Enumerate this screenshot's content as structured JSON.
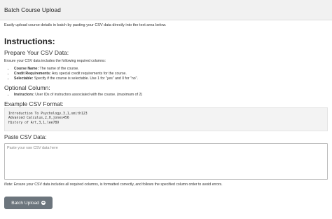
{
  "header": {
    "title": "Batch Course Upload"
  },
  "intro": "Easily upload course details in batch by pasting your CSV data directly into the text area below.",
  "instructions": {
    "heading": "Instructions:",
    "prepare_heading": "Prepare Your CSV Data:",
    "ensure_text": "Ensure your CSV data includes the following required columns:",
    "required": [
      {
        "term": "Course Name:",
        "desc": " The name of the course."
      },
      {
        "term": "Credit Requirements:",
        "desc": " Any special credit requirements for the course."
      },
      {
        "term": "Selectable:",
        "desc": " Specify if the course is selectable. Use 1 for \"yes\" and 0 for \"no\"."
      }
    ],
    "optional_heading": "Optional Column:",
    "optional": [
      {
        "term": "Instructors:",
        "desc": " User IDs of instructors associated with the course. (maximum of 2)"
      }
    ],
    "example_heading": "Example CSV Format:",
    "example_lines": [
      "Introduction To Psychology,3,1,smith123",
      "Advanced Calculus,2,0,jones456",
      "History of Art,3,1,lee789"
    ]
  },
  "paste": {
    "heading": "Paste CSV Data:",
    "placeholder": "Paste your raw CSV data here"
  },
  "note": {
    "label": "Note:",
    "text": " Ensure your CSV data includes all required columns, is formatted correctly, and follows the specified column order to avoid errors."
  },
  "button": {
    "label": "Batch Upload",
    "icon": "arrow-circle-right-icon"
  },
  "colors": {
    "button_bg": "#6c757d",
    "header_bg": "#f1f1f1"
  }
}
